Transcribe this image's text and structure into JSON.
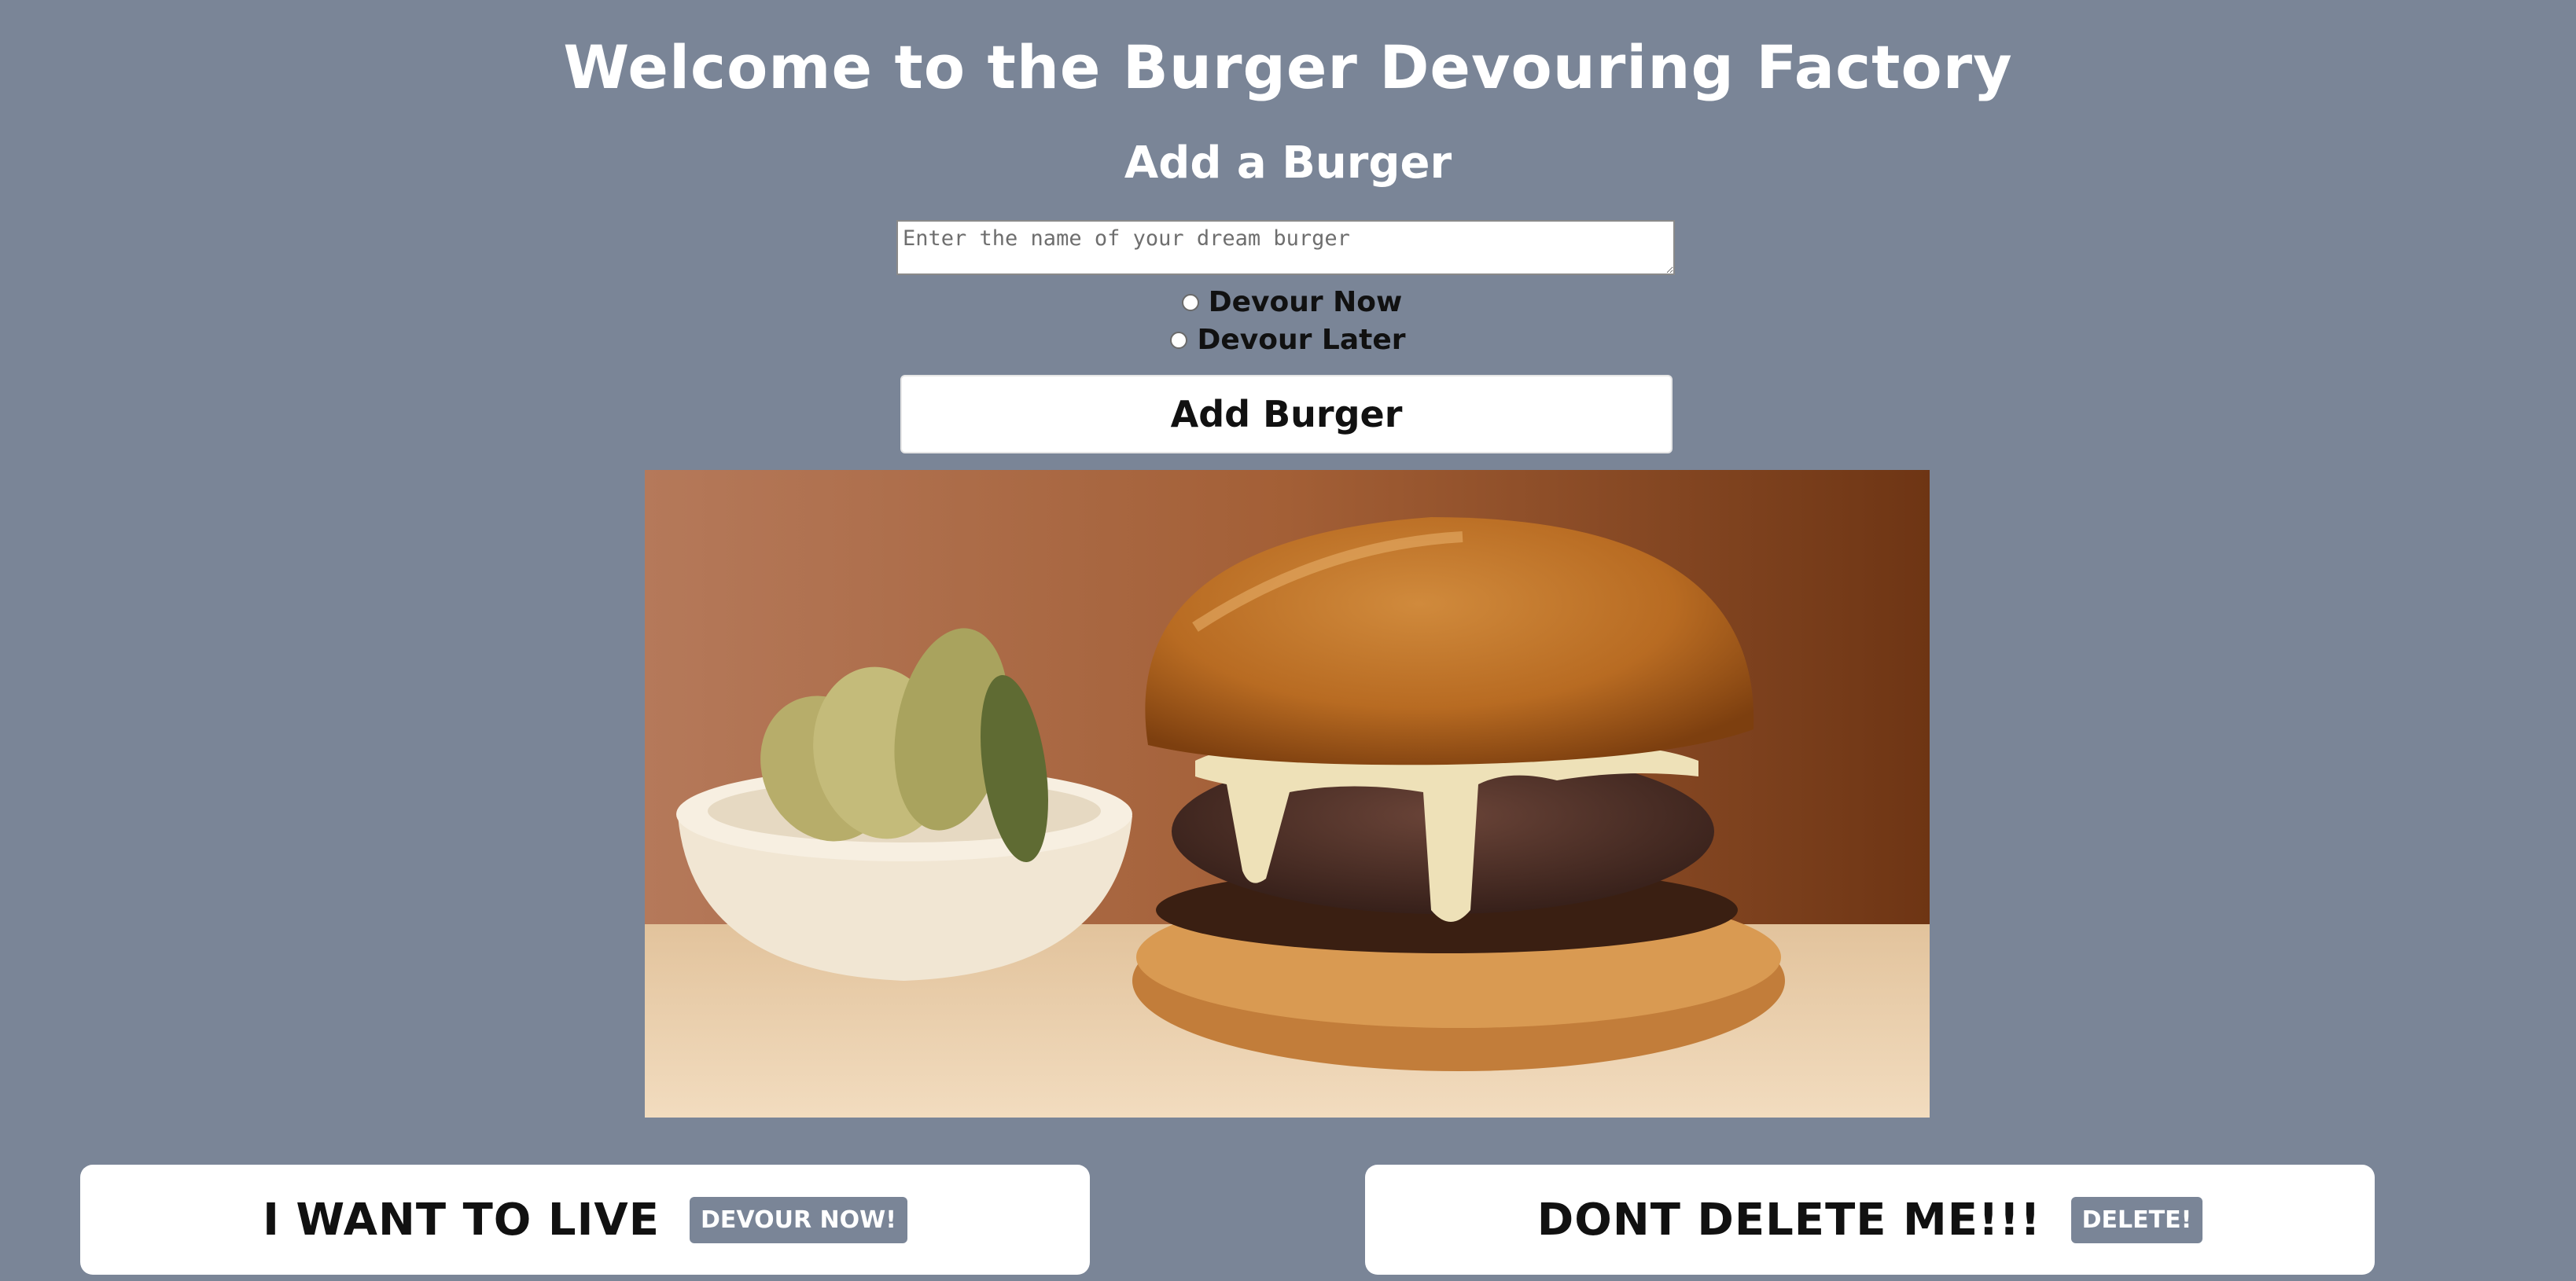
{
  "header": {
    "title": "Welcome to the Burger Devouring Factory",
    "subtitle": "Add a Burger"
  },
  "form": {
    "input_placeholder": "Enter the name of your dream burger",
    "input_value": "",
    "radio_options": [
      "Devour Now",
      "Devour Later"
    ],
    "submit_label": "Add Burger"
  },
  "burgers": {
    "left": {
      "name": "I WANT TO LIVE",
      "action_label": "DEVOUR NOW!"
    },
    "right": {
      "name": "DONT DELETE ME!!!",
      "action_label": "DELETE!"
    }
  },
  "colors": {
    "background": "#7a8597",
    "card": "#ffffff",
    "button_accent": "#7a8597"
  },
  "image": {
    "icon": "burger-photo"
  }
}
